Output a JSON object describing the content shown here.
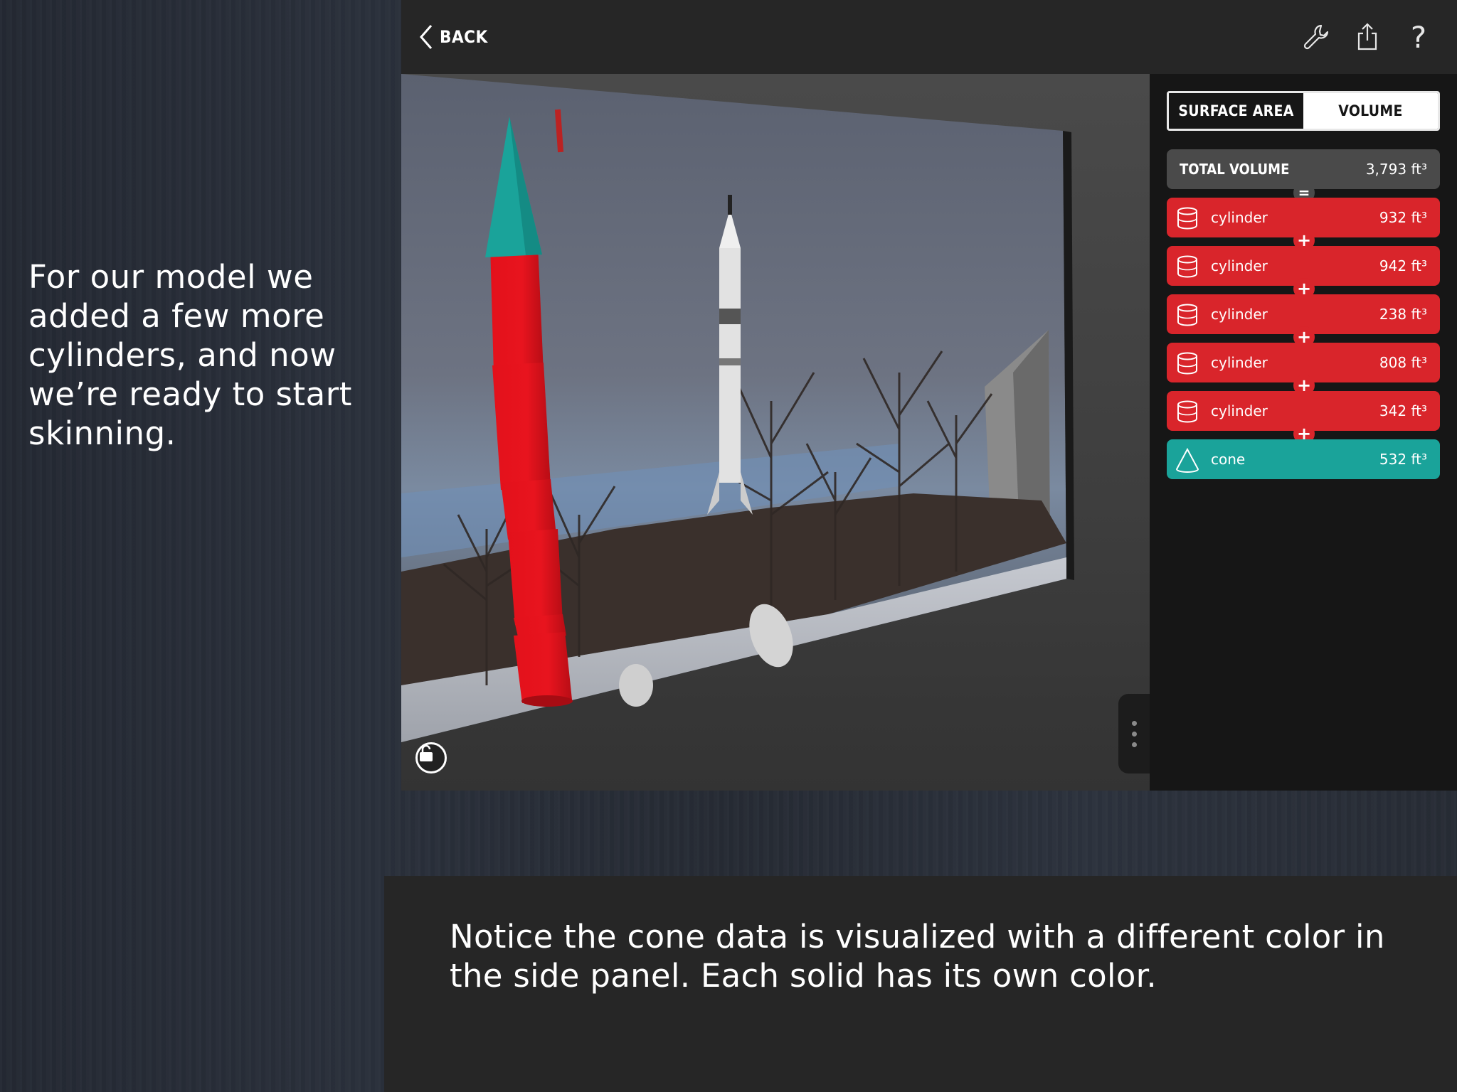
{
  "slide": {
    "left_caption": "For our model we added a few more cylinders, and now we’re ready to start skinning.",
    "bottom_caption": "Notice the cone data is visualized with a different color in the side panel. Each solid has its own color."
  },
  "app": {
    "back_label": "BACK",
    "icons": [
      "back-chevron-icon",
      "wrench-icon",
      "share-icon",
      "help-icon",
      "lock-icon"
    ],
    "help_glyph": "?",
    "tabs": [
      {
        "label": "SURFACE AREA",
        "active": false
      },
      {
        "label": "VOLUME",
        "active": true
      }
    ],
    "total": {
      "label": "TOTAL VOLUME",
      "value": "3,793 ft³"
    },
    "equals_op": "=",
    "plus_op": "+",
    "solids": [
      {
        "label": "cylinder",
        "value": "932 ft³",
        "color": "#d9252b",
        "icon": "cylinder-icon"
      },
      {
        "label": "cylinder",
        "value": "942 ft³",
        "color": "#d9252b",
        "icon": "cylinder-icon"
      },
      {
        "label": "cylinder",
        "value": "238 ft³",
        "color": "#d9252b",
        "icon": "cylinder-icon"
      },
      {
        "label": "cylinder",
        "value": "808 ft³",
        "color": "#d9252b",
        "icon": "cylinder-icon"
      },
      {
        "label": "cylinder",
        "value": "342 ft³",
        "color": "#d9252b",
        "icon": "cylinder-icon"
      },
      {
        "label": "cone",
        "value": "532 ft³",
        "color": "#1aa39a",
        "icon": "cone-icon"
      }
    ]
  }
}
